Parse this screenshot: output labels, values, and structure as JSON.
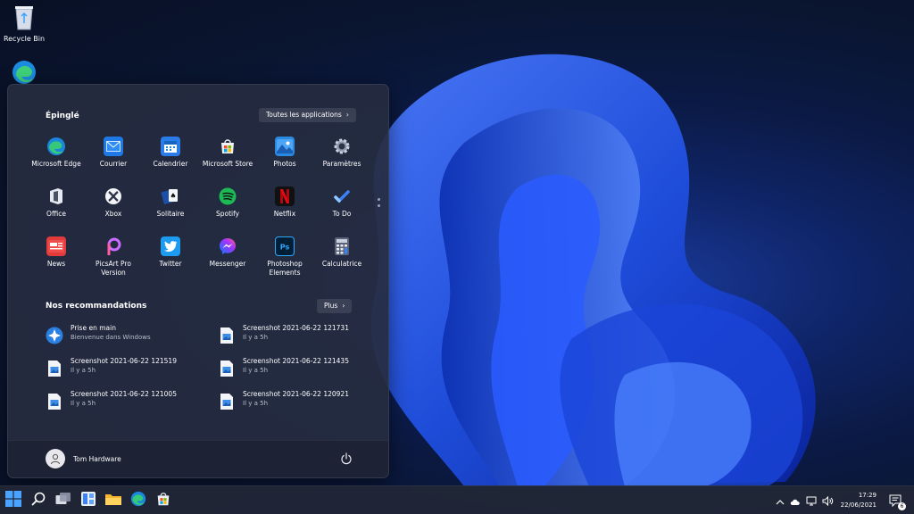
{
  "desktop": {
    "recycle_bin_label": "Recycle Bin"
  },
  "start_menu": {
    "pinned_title": "Épinglé",
    "all_apps_label": "Toutes les applications",
    "pinned_apps": [
      {
        "label": "Microsoft Edge",
        "icon": "edge-icon"
      },
      {
        "label": "Courrier",
        "icon": "mail-icon"
      },
      {
        "label": "Calendrier",
        "icon": "calendar-icon"
      },
      {
        "label": "Microsoft Store",
        "icon": "store-icon"
      },
      {
        "label": "Photos",
        "icon": "photos-icon"
      },
      {
        "label": "Paramètres",
        "icon": "gear-icon"
      },
      {
        "label": "Office",
        "icon": "office-icon"
      },
      {
        "label": "Xbox",
        "icon": "xbox-icon"
      },
      {
        "label": "Solitaire",
        "icon": "solitaire-icon"
      },
      {
        "label": "Spotify",
        "icon": "spotify-icon"
      },
      {
        "label": "Netflix",
        "icon": "netflix-icon"
      },
      {
        "label": "To Do",
        "icon": "todo-icon"
      },
      {
        "label": "News",
        "icon": "news-icon"
      },
      {
        "label": "PicsArt Pro Version",
        "icon": "picsart-icon"
      },
      {
        "label": "Twitter",
        "icon": "twitter-icon"
      },
      {
        "label": "Messenger",
        "icon": "messenger-icon"
      },
      {
        "label": "Photoshop Elements",
        "icon": "photoshop-icon"
      },
      {
        "label": "Calculatrice",
        "icon": "calculator-icon"
      }
    ],
    "recommended_title": "Nos recommandations",
    "more_label": "Plus",
    "recommended": [
      {
        "title": "Prise en main",
        "subtitle": "Bienvenue dans Windows",
        "icon": "get-started-icon"
      },
      {
        "title": "Screenshot 2021-06-22 121731",
        "subtitle": "Il y a 5h",
        "icon": "image-file-icon"
      },
      {
        "title": "Screenshot 2021-06-22 121519",
        "subtitle": "Il y a 5h",
        "icon": "image-file-icon"
      },
      {
        "title": "Screenshot 2021-06-22 121435",
        "subtitle": "Il y a 5h",
        "icon": "image-file-icon"
      },
      {
        "title": "Screenshot 2021-06-22 121005",
        "subtitle": "Il y a 5h",
        "icon": "image-file-icon"
      },
      {
        "title": "Screenshot 2021-06-22 120921",
        "subtitle": "Il y a 5h",
        "icon": "image-file-icon"
      }
    ],
    "user_name": "Tom Hardware"
  },
  "taskbar": {
    "time": "17:29",
    "date": "22/06/2021",
    "notification_count": "6"
  },
  "colors": {
    "accent": "#3b82f6",
    "menu_bg": "#262c40",
    "taskbar_bg": "#202636"
  }
}
